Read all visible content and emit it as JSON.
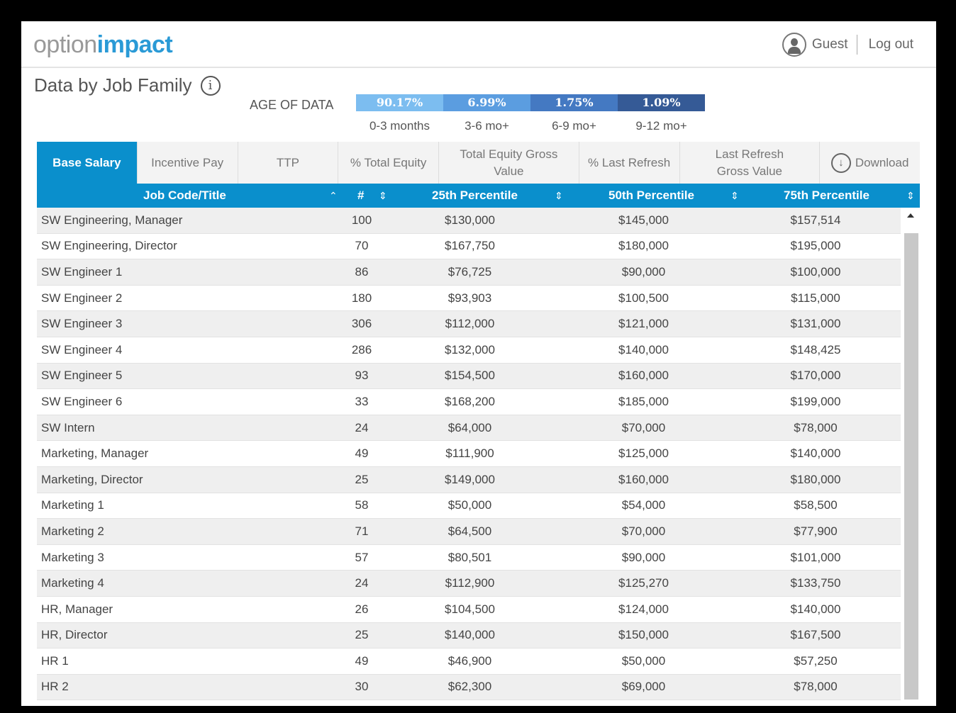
{
  "header": {
    "logo_light": "option",
    "logo_bold": "impact",
    "user": "Guest",
    "logout": "Log out"
  },
  "page": {
    "title": "Data by Job Family"
  },
  "age_of_data": {
    "label": "AGE OF DATA",
    "segments": [
      {
        "pct": "90.17%",
        "label": "0-3 months",
        "color": "#7cbdf0"
      },
      {
        "pct": "6.99%",
        "label": "3-6 mo+",
        "color": "#5b9de0"
      },
      {
        "pct": "1.75%",
        "label": "6-9 mo+",
        "color": "#4479c2"
      },
      {
        "pct": "1.09%",
        "label": "9-12 mo+",
        "color": "#355a96"
      }
    ]
  },
  "tabs": [
    "Base Salary",
    "Incentive Pay",
    "TTP",
    "% Total Equity",
    "Total Equity Gross Value",
    "% Last Refresh",
    "Last Refresh Gross Value"
  ],
  "download": "Download",
  "columns": [
    "Job Code/Title",
    "#",
    "25th Percentile",
    "50th Percentile",
    "75th Percentile"
  ],
  "rows": [
    [
      "SW Engineering, Manager",
      "100",
      "$130,000",
      "$145,000",
      "$157,514"
    ],
    [
      "SW Engineering, Director",
      "70",
      "$167,750",
      "$180,000",
      "$195,000"
    ],
    [
      "SW Engineer 1",
      "86",
      "$76,725",
      "$90,000",
      "$100,000"
    ],
    [
      "SW Engineer 2",
      "180",
      "$93,903",
      "$100,500",
      "$115,000"
    ],
    [
      "SW Engineer 3",
      "306",
      "$112,000",
      "$121,000",
      "$131,000"
    ],
    [
      "SW Engineer 4",
      "286",
      "$132,000",
      "$140,000",
      "$148,425"
    ],
    [
      "SW Engineer 5",
      "93",
      "$154,500",
      "$160,000",
      "$170,000"
    ],
    [
      "SW Engineer 6",
      "33",
      "$168,200",
      "$185,000",
      "$199,000"
    ],
    [
      "SW Intern",
      "24",
      "$64,000",
      "$70,000",
      "$78,000"
    ],
    [
      "Marketing, Manager",
      "49",
      "$111,900",
      "$125,000",
      "$140,000"
    ],
    [
      "Marketing, Director",
      "25",
      "$149,000",
      "$160,000",
      "$180,000"
    ],
    [
      "Marketing 1",
      "58",
      "$50,000",
      "$54,000",
      "$58,500"
    ],
    [
      "Marketing 2",
      "71",
      "$64,500",
      "$70,000",
      "$77,900"
    ],
    [
      "Marketing 3",
      "57",
      "$80,501",
      "$90,000",
      "$101,000"
    ],
    [
      "Marketing 4",
      "24",
      "$112,900",
      "$125,270",
      "$133,750"
    ],
    [
      "HR, Manager",
      "26",
      "$104,500",
      "$124,000",
      "$140,000"
    ],
    [
      "HR, Director",
      "25",
      "$140,000",
      "$150,000",
      "$167,500"
    ],
    [
      "HR 1",
      "49",
      "$46,900",
      "$50,000",
      "$57,250"
    ],
    [
      "HR 2",
      "30",
      "$62,300",
      "$69,000",
      "$78,000"
    ]
  ]
}
